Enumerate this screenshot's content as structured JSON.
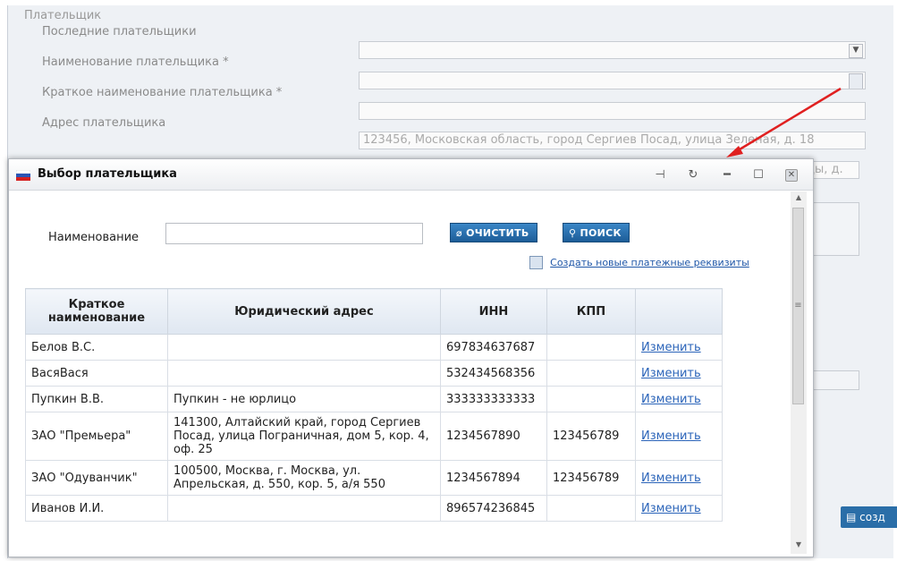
{
  "form": {
    "section_title": "Плательщик",
    "rows": [
      {
        "label": "Последние плательщики",
        "value": ""
      },
      {
        "label": "Наименование плательщика *",
        "value": ""
      },
      {
        "label": "Краткое наименование плательщика *",
        "value": ""
      },
      {
        "label": "Адрес плательщика",
        "value": "123456, Московская область, город Сергиев Посад, улица Зеленая, д. 18"
      }
    ],
    "hidden_field_tail": "еды, д.",
    "create_button_label": "созд"
  },
  "dialog": {
    "title": "Выбор плательщика",
    "name_label": "Наименование",
    "name_value": "",
    "clear_button": "ОЧИСТИТЬ",
    "search_button": "ПОИСК",
    "create_link": "Создать новые платежные реквизиты",
    "table": {
      "headers": [
        "Краткое наименование",
        "Юридический адрес",
        "ИНН",
        "КПП",
        ""
      ],
      "rows": [
        {
          "short_name": "Белов В.С.",
          "address": "",
          "inn": "697834637687",
          "kpp": "",
          "action": "Изменить"
        },
        {
          "short_name": "ВасяВася",
          "address": "",
          "inn": "532434568356",
          "kpp": "",
          "action": "Изменить"
        },
        {
          "short_name": "Пупкин В.В.",
          "address": "Пупкин - не юрлицо",
          "inn": "333333333333",
          "kpp": "",
          "action": "Изменить"
        },
        {
          "short_name": "ЗАО \"Премьера\"",
          "address": "141300, Алтайский край, город Сергиев Посад, улица Пограничная, дом 5, кор. 4, оф. 25",
          "inn": "1234567890",
          "kpp": "123456789",
          "action": "Изменить"
        },
        {
          "short_name": "ЗАО \"Одуванчик\"",
          "address": "100500, Москва, г. Москва, ул. Апрельская, д. 550, кор. 5, а/я 550",
          "inn": "1234567894",
          "kpp": "123456789",
          "action": "Изменить"
        },
        {
          "short_name": "Иванов И.И.",
          "address": "",
          "inn": "896574236845",
          "kpp": "",
          "action": "Изменить"
        }
      ]
    }
  },
  "colors": {
    "accent": "#2a6ea8",
    "link": "#2b64b9",
    "arrow": "#e02020"
  }
}
